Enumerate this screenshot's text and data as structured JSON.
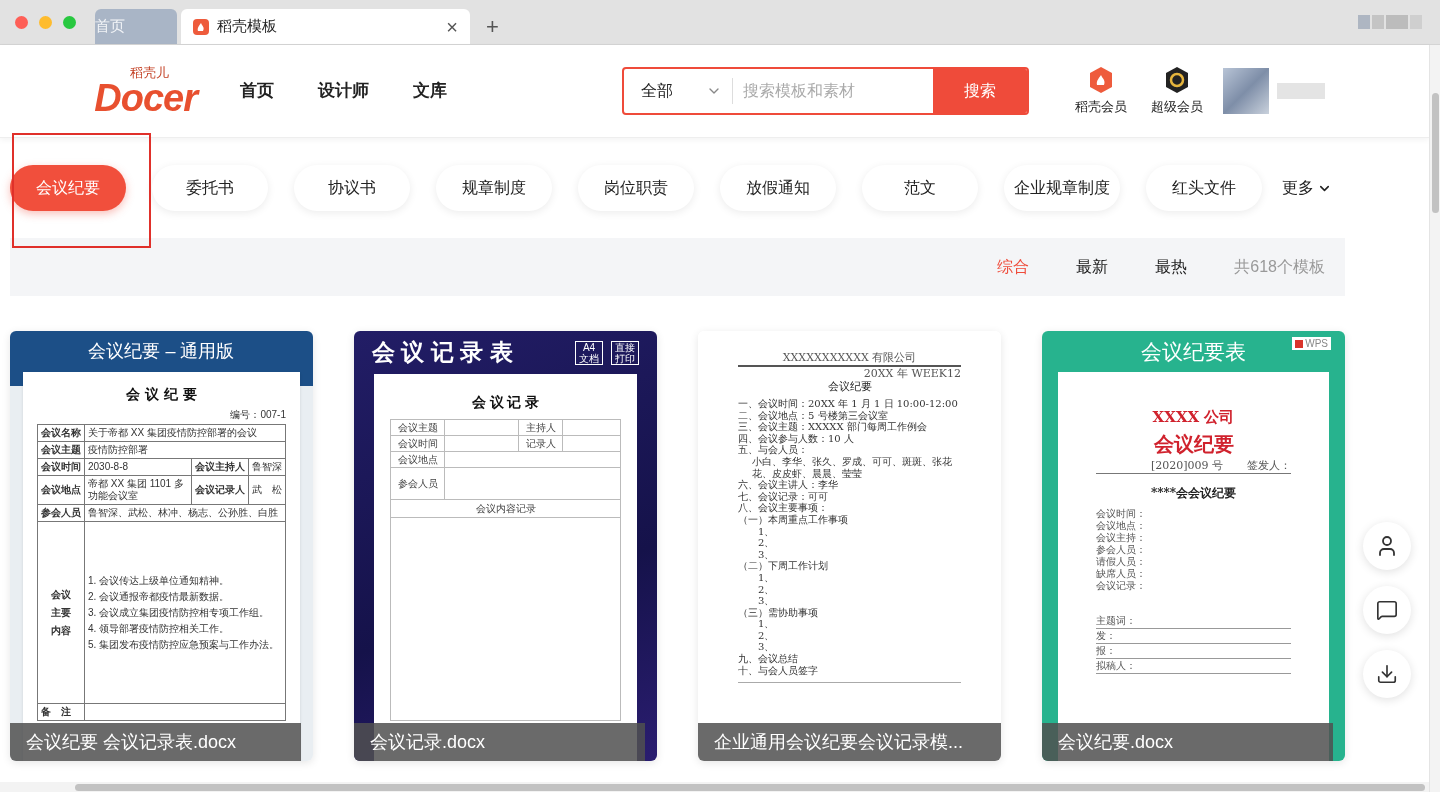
{
  "browser": {
    "tabs": [
      {
        "label": "首页",
        "selected": false
      },
      {
        "label": "稻壳模板",
        "selected": true
      }
    ],
    "close": "×",
    "new_tab": "+"
  },
  "header": {
    "logo": {
      "tagline": "稻壳儿",
      "wordmark": "Docer"
    },
    "nav": [
      "首页",
      "设计师",
      "文库"
    ],
    "search": {
      "scope": "全部",
      "placeholder": "搜索模板和素材",
      "button": "搜索"
    },
    "memberships": [
      {
        "label": "稻壳会员",
        "kind": "docer"
      },
      {
        "label": "超级会员",
        "kind": "super"
      }
    ]
  },
  "categories": [
    {
      "label": "会议纪要",
      "selected": true
    },
    {
      "label": "委托书",
      "selected": false
    },
    {
      "label": "协议书",
      "selected": false
    },
    {
      "label": "规章制度",
      "selected": false
    },
    {
      "label": "岗位职责",
      "selected": false
    },
    {
      "label": "放假通知",
      "selected": false
    },
    {
      "label": "范文",
      "selected": false
    },
    {
      "label": "企业规章制度",
      "selected": false
    },
    {
      "label": "红头文件",
      "selected": false
    }
  ],
  "more": "更多",
  "sort": {
    "options": [
      {
        "label": "综合",
        "selected": true
      },
      {
        "label": "最新",
        "selected": false
      },
      {
        "label": "最热",
        "selected": false
      }
    ],
    "count": "共618个模板"
  },
  "cards": [
    {
      "kind": "form_table",
      "banner": "会议纪要 – 通用版",
      "title": "会 议 纪 要",
      "number": "编号：007-1",
      "rows": [
        {
          "label": "会议名称",
          "value": "关于帝都 XX 集团疫情防控部署的会议"
        },
        {
          "label": "会议主题",
          "value": "疫情防控部署"
        },
        {
          "label": "会议时间",
          "value": "2030-8-8",
          "label2": "会议主持人",
          "value2": "鲁智深"
        },
        {
          "label": "会议地点",
          "value": "帝都 XX 集团 1101 多功能会议室",
          "label2": "会议记录人",
          "value2": "武　松"
        },
        {
          "label": "参会人员",
          "value": "鲁智深、武松、林冲、杨志、公孙胜、白胜"
        }
      ],
      "content_label": [
        "会议",
        "主要",
        "内容"
      ],
      "items": [
        "1. 会议传达上级单位通知精神。",
        "2. 会议通报帝都疫情最新数据。",
        "3. 会议成立集团疫情防控相专项工作组。",
        "4. 领导部署疫情防控相关工作。",
        "5. 集团发布疫情防控应急预案与工作办法。"
      ],
      "remark": "备　注",
      "caption": "会议纪要 会议记录表.docx"
    },
    {
      "kind": "record_form",
      "banner": "会 议 记 录 表",
      "badges": [
        [
          "A4",
          "文档"
        ],
        [
          "直接",
          "打印"
        ]
      ],
      "title": "会 议 记 录",
      "rows": [
        {
          "label": "会议主题",
          "label2": "主持人"
        },
        {
          "label": "会议时间",
          "label2": "记录人"
        },
        {
          "label": "会议地点"
        },
        {
          "label": "参会人员"
        }
      ],
      "section": "会议内容记录",
      "caption": "会议记录.docx"
    },
    {
      "kind": "memo_text",
      "company": "XXXXXXXXXXX 有限公司",
      "week": "20XX 年 WEEK12",
      "title": "会议纪要",
      "lines": [
        {
          "kind": "heading",
          "text": "一、会议时间：20XX 年 1 月 1 日 10:00-12:00"
        },
        {
          "kind": "heading",
          "text": "二、会议地点：5 号楼第三会议室"
        },
        {
          "kind": "heading",
          "text": "三、会议主题：XXXXX 部门每周工作例会"
        },
        {
          "kind": "heading",
          "text": "四、会议参与人数：10 人"
        },
        {
          "kind": "heading",
          "text": "五、与会人员："
        },
        {
          "kind": "note",
          "text": "小白、李华、张久、罗成、可可、斑斑、张花花、皮皮虾、晨晨、莹莹"
        },
        {
          "kind": "heading",
          "text": "六、会议主讲人：李华"
        },
        {
          "kind": "heading",
          "text": "七、会议记录：可可"
        },
        {
          "kind": "heading",
          "text": "八、会议主要事项："
        },
        {
          "kind": "section",
          "text": "（一）本周重点工作事项"
        },
        {
          "kind": "number",
          "text": "1、"
        },
        {
          "kind": "number",
          "text": "2、"
        },
        {
          "kind": "number",
          "text": "3、"
        },
        {
          "kind": "section",
          "text": "（二）下周工作计划"
        },
        {
          "kind": "number",
          "text": "1、"
        },
        {
          "kind": "number",
          "text": "2、"
        },
        {
          "kind": "number",
          "text": "3、"
        },
        {
          "kind": "section",
          "text": "（三）需协助事项"
        },
        {
          "kind": "number",
          "text": "1、"
        },
        {
          "kind": "number",
          "text": "2、"
        },
        {
          "kind": "number",
          "text": "3、"
        },
        {
          "kind": "heading",
          "text": "九、会议总结"
        },
        {
          "kind": "heading",
          "text": "十、与会人员签字"
        }
      ],
      "caption": "企业通用会议纪要会议记录模..."
    },
    {
      "kind": "red_header",
      "banner": "会议纪要表",
      "badge": "WPS",
      "company": "XXXX 公司",
      "title": "会议纪要",
      "ref": "[2020]009 号",
      "signer": "签发人：",
      "subtitle": "****会会议纪要",
      "fields": [
        "会议时间：",
        "会议地点：",
        "会议主持：",
        "参会人员：",
        "请假人员：",
        "缺席人员：",
        "会议记录："
      ],
      "footer": [
        "主题词：",
        "发：",
        "报：",
        "拟稿人："
      ],
      "caption": "会议纪要.docx"
    }
  ]
}
